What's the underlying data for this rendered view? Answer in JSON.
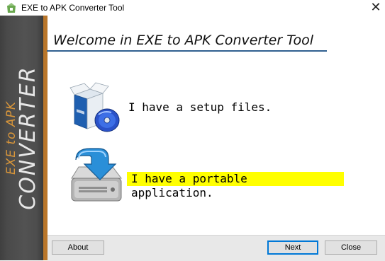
{
  "window": {
    "title": "EXE to APK Converter Tool",
    "close_glyph": "✕"
  },
  "sidebar": {
    "small_text": "EXE to APK",
    "big_text": "CONVERTER"
  },
  "header": {
    "welcome": "Welcome in EXE to APK Converter Tool"
  },
  "options": {
    "setup_label": "I have a setup files.",
    "portable_label": "I have a portable application.",
    "setup_icon": "software-box-cd-icon",
    "portable_icon": "hard-drive-download-icon"
  },
  "buttons": {
    "about": "About",
    "next": "Next",
    "close": "Close"
  },
  "colors": {
    "highlight": "#ffff00",
    "accent_line": "#2f5f8f",
    "sidebar_orange": "#d9963a"
  }
}
